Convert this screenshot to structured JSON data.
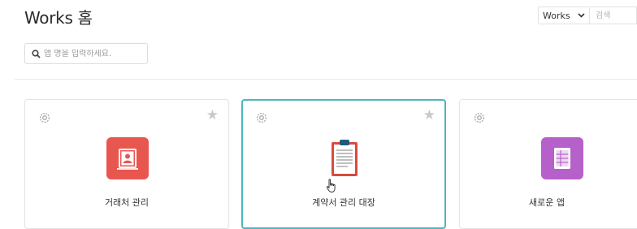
{
  "header": {
    "title": "Works 홈",
    "scope_select": "Works",
    "search_placeholder": "검색"
  },
  "app_search": {
    "placeholder": "앱 명을 입력하세요."
  },
  "apps": [
    {
      "name": "거래처 관리",
      "icon": "contact-book-icon",
      "color": "#e8574f",
      "active": false
    },
    {
      "name": "계약서 관리 대장",
      "icon": "clipboard-icon",
      "color": "#d94a3f",
      "active": true
    },
    {
      "name": "새로운 앱",
      "icon": "spreadsheet-doc-icon",
      "color": "#b660c9",
      "active": false
    }
  ],
  "colors": {
    "accent_border": "#4fb5bd",
    "star": "#c9c9c9"
  }
}
